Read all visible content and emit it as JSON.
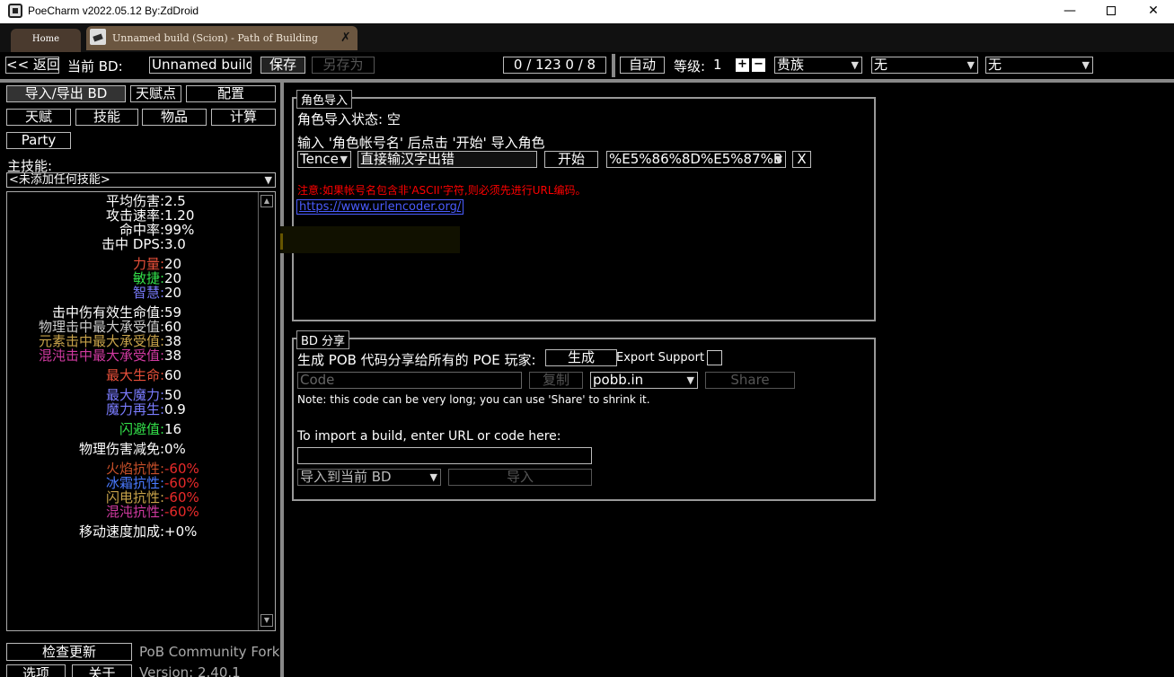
{
  "window": {
    "title": "PoeCharm v2022.05.12 By:ZdDroid",
    "min": "—",
    "close": "✕"
  },
  "tabs": {
    "home": "Home",
    "build": "Unnamed build (Scion) - Path of Building",
    "close": "✗"
  },
  "toolbar": {
    "back": "<< 返回",
    "current_bd_label": "当前 BD:",
    "build_name": "Unnamed build",
    "save": "保存",
    "save_as": "另存为",
    "points": "0 / 123   0 / 8",
    "auto": "自动",
    "level_label": "等级:",
    "level_value": "1",
    "plus": "+",
    "minus": "−",
    "class_select": "贵族",
    "ascendancy_select": "无",
    "bandit_select": "无"
  },
  "left_nav": {
    "import_export": "导入/导出 BD",
    "passive_points": "天赋点",
    "config": "配置",
    "tree": "天赋",
    "skills": "技能",
    "items": "物品",
    "calcs": "计算",
    "party": "Party",
    "main_skill_label": "主技能:",
    "main_skill_select": "<未添加任何技能>"
  },
  "stats": [
    {
      "key": "平均伤害:",
      "value": "2.5",
      "color": "#ffffff",
      "value_color": "#ffffff"
    },
    {
      "key": "攻击速率:",
      "value": "1.20",
      "color": "#ffffff",
      "value_color": "#ffffff"
    },
    {
      "key": "命中率:",
      "value": "99%",
      "color": "#ffffff",
      "value_color": "#ffffff"
    },
    {
      "key": "击中 DPS:",
      "value": "3.0",
      "color": "#ffffff",
      "value_color": "#ffffff"
    },
    {
      "key": "力量:",
      "value": "20",
      "color": "#e8503a",
      "value_color": "#ffffff"
    },
    {
      "key": "敏捷:",
      "value": "20",
      "color": "#33e04a",
      "value_color": "#ffffff"
    },
    {
      "key": "智慧:",
      "value": "20",
      "color": "#7a7cff",
      "value_color": "#ffffff"
    },
    {
      "key": "击中伤有效生命值:",
      "value": "59",
      "color": "#ffffff",
      "value_color": "#ffffff"
    },
    {
      "key": "物理击中最大承受值:",
      "value": "60",
      "color": "#cccccc",
      "value_color": "#ffffff"
    },
    {
      "key": "元素击中最大承受值:",
      "value": "38",
      "color": "#c8a34a",
      "value_color": "#ffffff"
    },
    {
      "key": "混沌击中最大承受值:",
      "value": "38",
      "color": "#d03aa0",
      "value_color": "#ffffff"
    },
    {
      "key": "最大生命:",
      "value": "60",
      "color": "#e8503a",
      "value_color": "#ffffff"
    },
    {
      "key": "最大魔力:",
      "value": "50",
      "color": "#7a7cff",
      "value_color": "#ffffff"
    },
    {
      "key": "魔力再生:",
      "value": "0.9",
      "color": "#7a7cff",
      "value_color": "#ffffff"
    },
    {
      "key": "闪避值:",
      "value": "16",
      "color": "#33e04a",
      "value_color": "#ffffff"
    },
    {
      "key": "物理伤害减免:",
      "value": "0%",
      "color": "#ffffff",
      "value_color": "#ffffff"
    },
    {
      "key": "火焰抗性:",
      "value": "-60%",
      "color": "#c8502a",
      "value_color": "#e82a2a"
    },
    {
      "key": "冰霜抗性:",
      "value": "-60%",
      "color": "#4a7aff",
      "value_color": "#e82a2a"
    },
    {
      "key": "闪电抗性:",
      "value": "-60%",
      "color": "#c8a34a",
      "value_color": "#e82a2a"
    },
    {
      "key": "混沌抗性:",
      "value": "-60%",
      "color": "#d03aa0",
      "value_color": "#e82a2a"
    },
    {
      "key": "移动速度加成:",
      "value": "+0%",
      "color": "#ffffff",
      "value_color": "#ffffff"
    }
  ],
  "bottom_left": {
    "check_update": "检查更新",
    "fork_label": "PoB Community Fork",
    "options": "选项",
    "about": "关于",
    "version": "Version: 2.40.1"
  },
  "import_panel": {
    "title": "角色导入",
    "status": "角色导入状态: 空",
    "instruction": "输入 '角色帐号名' 后点击 '开始' 导入角色",
    "realm_select": "Tence",
    "account_input": "直接输汉字出错",
    "start": "开始",
    "encoded_select": "%E5%86%8D%E5%87%B",
    "clear": "X",
    "warning": "注意:如果帐号名包含非'ASCII'字符,则必须先进行URL编码。",
    "link": "https://www.urlencoder.org/"
  },
  "share_panel": {
    "title": "BD 分享",
    "generate_label": "生成 POB 代码分享给所有的 POE 玩家:",
    "generate": "生成",
    "export_support": "Export Support",
    "code_placeholder": "Code",
    "copy": "复制",
    "site_select": "pobb.in",
    "share": "Share",
    "note": "Note: this code can be very long; you can use 'Share' to shrink it.",
    "import_label": "To import a build, enter URL or code here:",
    "import_input": "",
    "import_mode_select": "导入到当前 BD",
    "import_button": "导入"
  }
}
